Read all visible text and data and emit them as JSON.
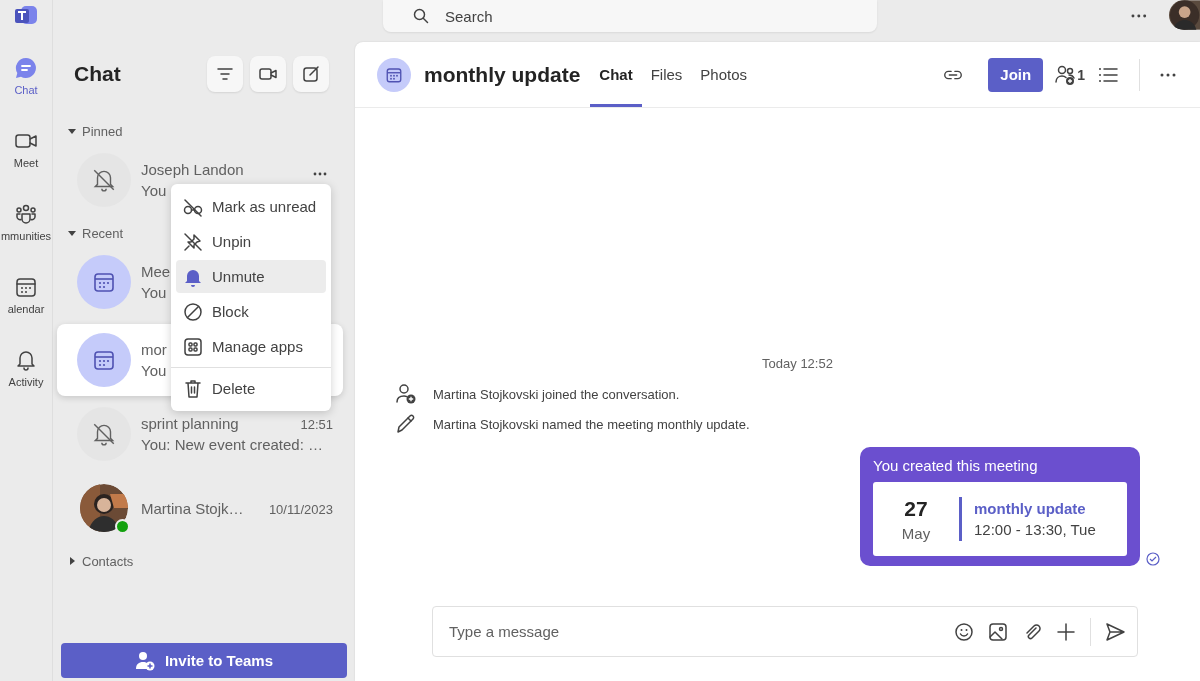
{
  "app_rail": {
    "items": [
      {
        "kind": "chat",
        "label": "Chat",
        "selected": true
      },
      {
        "kind": "meet",
        "label": "Meet",
        "selected": false
      },
      {
        "kind": "communities",
        "label": "mmunities",
        "selected": false
      },
      {
        "kind": "calendar",
        "label": "alendar",
        "selected": false
      },
      {
        "kind": "activity",
        "label": "Activity",
        "selected": false
      }
    ]
  },
  "top_bar": {
    "search": {
      "placeholder": "Search"
    }
  },
  "chat_list": {
    "title": "Chat",
    "sections": [
      {
        "label": "Pinned",
        "expanded": true,
        "chats": [
          {
            "kind": "muted",
            "name": "Joseph Landon",
            "preview": "You",
            "selected": false
          }
        ]
      },
      {
        "label": "Recent",
        "expanded": true,
        "chats": [
          {
            "kind": "meeting",
            "name": "Mee",
            "preview": "You",
            "selected": false
          },
          {
            "kind": "meeting",
            "name": "mor",
            "preview": "You",
            "selected": true
          },
          {
            "kind": "muted",
            "name": "sprint planning",
            "time": "12:51",
            "preview": "You: New event created: …",
            "selected": false
          },
          {
            "kind": "picture",
            "name": "Martina Stojk…",
            "time": "10/11/2023",
            "color": "#13a10e",
            "selected": false
          }
        ]
      },
      {
        "label": "Contacts",
        "expanded": false
      }
    ]
  },
  "invite_button": "Invite to Teams",
  "context_menu": {
    "items": [
      {
        "kind": "unread",
        "label": "Mark as unread",
        "selected": false,
        "divider_before": false
      },
      {
        "kind": "unpin",
        "label": "Unpin",
        "selected": false,
        "divider_before": false
      },
      {
        "kind": "unmute",
        "label": "Unmute",
        "selected": true,
        "divider_before": false
      },
      {
        "kind": "block",
        "label": "Block",
        "selected": false,
        "divider_before": false
      },
      {
        "kind": "apps",
        "label": "Manage apps",
        "selected": false,
        "divider_before": false
      },
      {
        "kind": "delete",
        "label": "Delete",
        "selected": false,
        "divider_before": true
      }
    ]
  },
  "conversation": {
    "title": "monthly update",
    "tabs": [
      {
        "label": "Chat",
        "selected": true
      },
      {
        "label": "Files",
        "selected": false
      },
      {
        "label": "Photos",
        "selected": false
      }
    ],
    "join_button": "Join",
    "participant_count": "1",
    "timestamp": "Today 12:52",
    "events": [
      {
        "kind": "joined",
        "text": "Martina Stojkovski joined the conversation."
      },
      {
        "kind": "renamed",
        "text": "Martina Stojkovski named the meeting monthly update."
      }
    ],
    "meeting_card": {
      "heading": "You created this meeting",
      "day": "27",
      "month": "May",
      "title": "monthly update",
      "time": "12:00 - 13:30, Tue"
    },
    "compose": {
      "placeholder": "Type a message"
    }
  }
}
